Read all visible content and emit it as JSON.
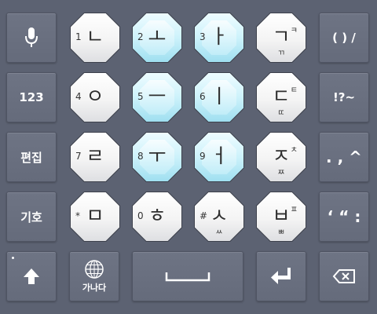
{
  "keyboard": {
    "left": {
      "mic_icon": "microphone-icon",
      "numbers": "123",
      "edit": "편집",
      "symbols": "기호",
      "shift_icon": "shift-arrow-icon"
    },
    "right": {
      "punct1": "( ) /",
      "punct2": "!?~",
      "punct3": ". , ^",
      "punct4": "‘ “ :",
      "backspace_icon": "backspace-icon"
    },
    "keys": [
      {
        "main": "ㄴ",
        "num": "1",
        "corner": "",
        "bottom": "",
        "color": "white"
      },
      {
        "main": "ㅗ",
        "num": "2",
        "corner": "",
        "bottom": "",
        "color": "blue"
      },
      {
        "main": "ㅏ",
        "num": "3",
        "corner": "",
        "bottom": "",
        "color": "blue"
      },
      {
        "main": "ㄱ",
        "num": "",
        "corner": "ㅋ",
        "bottom": "ㄲ",
        "color": "white"
      },
      {
        "main": "ㅇ",
        "num": "4",
        "corner": "",
        "bottom": "",
        "color": "white"
      },
      {
        "main": "ㅡ",
        "num": "5",
        "corner": "",
        "bottom": "",
        "color": "blue"
      },
      {
        "main": "ㅣ",
        "num": "6",
        "corner": "",
        "bottom": "",
        "color": "blue"
      },
      {
        "main": "ㄷ",
        "num": "",
        "corner": "ㅌ",
        "bottom": "ㄸ",
        "color": "white"
      },
      {
        "main": "ㄹ",
        "num": "7",
        "corner": "",
        "bottom": "",
        "color": "white"
      },
      {
        "main": "ㅜ",
        "num": "8",
        "corner": "",
        "bottom": "",
        "color": "blue"
      },
      {
        "main": "ㅓ",
        "num": "9",
        "corner": "",
        "bottom": "",
        "color": "blue"
      },
      {
        "main": "ㅈ",
        "num": "",
        "corner": "ㅊ",
        "bottom": "ㅉ",
        "color": "white"
      },
      {
        "main": "ㅁ",
        "num": "*",
        "corner": "",
        "bottom": "",
        "color": "white"
      },
      {
        "main": "ㅎ",
        "num": "0",
        "corner": "",
        "bottom": "",
        "color": "white"
      },
      {
        "main": "ㅅ",
        "num": "#",
        "corner": "",
        "bottom": "ㅆ",
        "color": "white"
      },
      {
        "main": "ㅂ",
        "num": "",
        "corner": "ㅍ",
        "bottom": "ㅃ",
        "color": "white"
      }
    ],
    "bottom_row": {
      "language_label": "가나다",
      "globe_icon": "globe-icon",
      "space_icon": "space-bar-icon",
      "enter_icon": "enter-arrow-icon"
    },
    "colors": {
      "background": "#5c6272",
      "vowel_key": "#cdf2fb",
      "consonant_key": "#f4f4f4"
    }
  }
}
